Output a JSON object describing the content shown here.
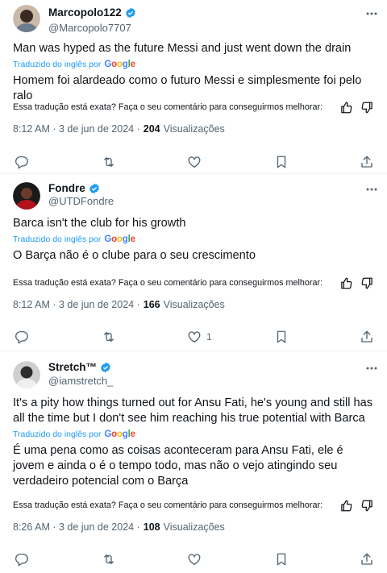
{
  "translation_label": "Traduzido do inglês por",
  "translation_provider": "Google",
  "feedback_question": "Essa tradução está exata? Faça o seu comentário para conseguirmos melhorar:",
  "views_label": "Visualizações",
  "posts": [
    {
      "author": "Marcopolo122",
      "handle": "@Marcopolo7707",
      "text": "Man was hyped as the future Messi and just went down the drain",
      "translation": "Homem foi alardeado como o futuro Messi e simplesmente foi pelo ralo",
      "time": "8:12 AM · 3 de jun de 2024 ·",
      "views": "204",
      "likes": ""
    },
    {
      "author": "Fondre",
      "handle": "@UTDFondre",
      "text": "Barca isn't the club for his growth",
      "translation": "O Barça não é o clube para o seu crescimento",
      "time": "8:12 AM · 3 de jun de 2024 ·",
      "views": "166",
      "likes": "1"
    },
    {
      "author": "Stretch™",
      "handle": "@iamstretch_",
      "text": "It's a pity how things turned out for Ansu Fati, he's young and still has all the time but I don't see him reaching his true potential with Barca",
      "translation": "É uma pena como as coisas aconteceram para Ansu Fati, ele é jovem e ainda o é o tempo todo, mas não o vejo atingindo seu verdadeiro potencial com o Barça",
      "time": "8:26 AM · 3 de jun de 2024 ·",
      "views": "108",
      "likes": ""
    }
  ],
  "colors": {
    "accent": "#1d9bf0",
    "secondary_text": "#536471",
    "primary_text": "#0f1419",
    "divider": "#eff3f4"
  }
}
